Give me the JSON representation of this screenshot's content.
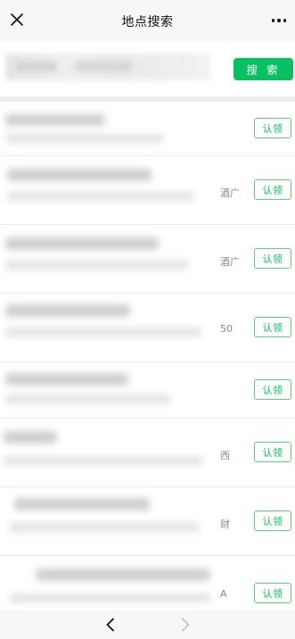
{
  "navbar": {
    "title": "地点搜索",
    "close_icon": "close-icon",
    "more_icon": "more-icon"
  },
  "search": {
    "button_label": "搜 索"
  },
  "results": [
    {
      "tail": "",
      "claim_label": "认领"
    },
    {
      "tail": "酒广",
      "claim_label": "认领"
    },
    {
      "tail": "酒广",
      "claim_label": "认领"
    },
    {
      "tail": "50",
      "claim_label": "认领"
    },
    {
      "tail": "",
      "claim_label": "认领"
    },
    {
      "tail": "西",
      "claim_label": "认领"
    },
    {
      "tail": "财",
      "claim_label": "认领"
    },
    {
      "tail": "A",
      "claim_label": "认领"
    }
  ],
  "bottom_nav": {
    "back_icon": "chevron-left-icon",
    "forward_icon": "chevron-right-icon"
  },
  "colors": {
    "accent": "#07c160",
    "claim_border": "#5ed17a",
    "navbar_bg": "#f7f7f7"
  }
}
